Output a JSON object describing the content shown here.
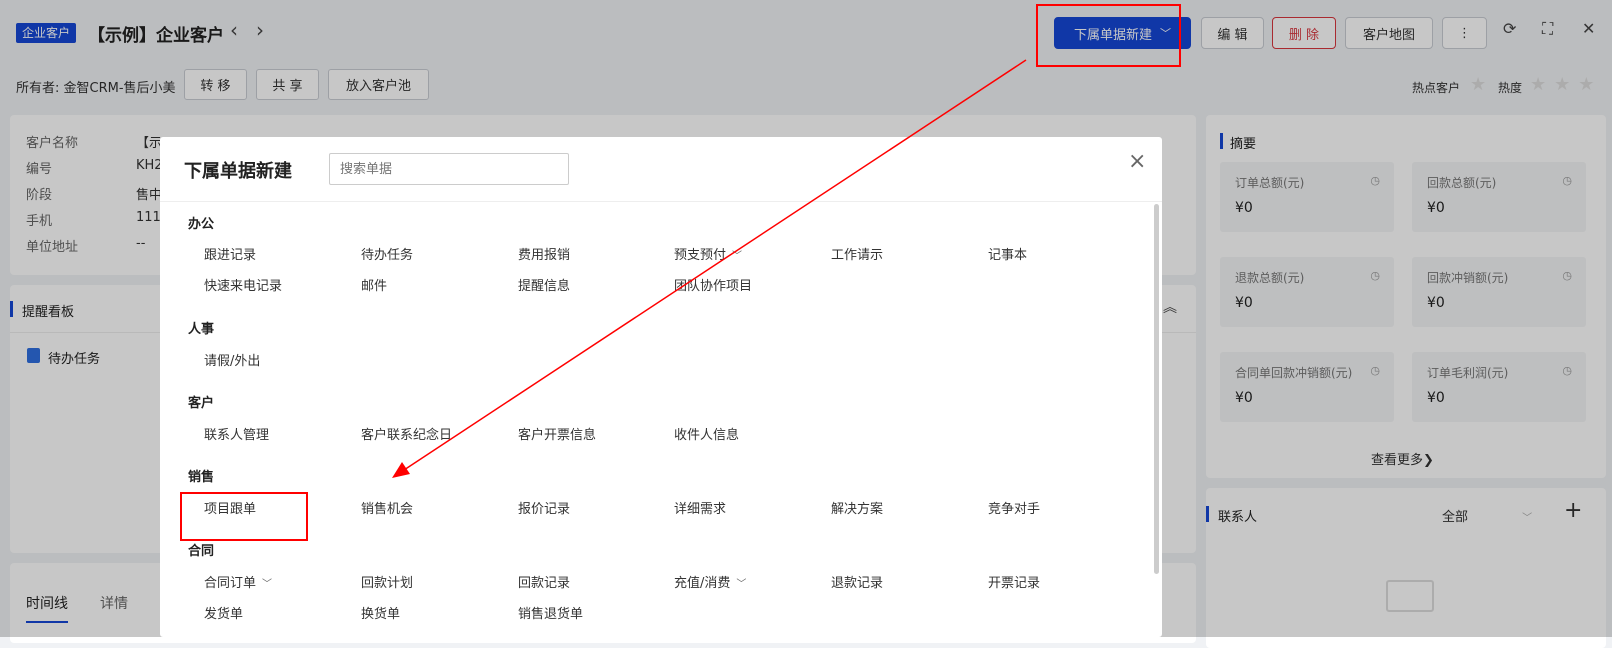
{
  "header": {
    "badge": "企业客户",
    "title": "【示例】企业客户",
    "prev_icon": "‹",
    "next_icon": "›",
    "new_sub_label": "下属单据新建",
    "edit_label": "编 辑",
    "delete_label": "删 除",
    "map_label": "客户地图",
    "more_icon": "⋮",
    "refresh_icon": "⟳",
    "fullscreen_icon": "⛶",
    "close_icon": "✕",
    "owner": "所有者: 金智CRM-售后小美",
    "transfer_label": "转 移",
    "share_label": "共 享",
    "pool_label": "放入客户池",
    "hot_label": "热点客户",
    "heat_label": "热度"
  },
  "info": {
    "labels": [
      "客户名称",
      "编号",
      "阶段",
      "手机",
      "单位地址"
    ],
    "values": [
      "【示",
      "KH2",
      "售中",
      "111",
      "--"
    ]
  },
  "reminder": {
    "title": "提醒看板",
    "item": "待办任务"
  },
  "tabs": [
    "时间线",
    "详情"
  ],
  "summary": {
    "title": "摘要",
    "items": [
      {
        "label": "订单总额(元)",
        "value": "¥0"
      },
      {
        "label": "回款总额(元)",
        "value": "¥0"
      },
      {
        "label": "退款总额(元)",
        "value": "¥0"
      },
      {
        "label": "回款冲销额(元)",
        "value": "¥0"
      },
      {
        "label": "合同单回款冲销额(元)",
        "value": "¥0"
      },
      {
        "label": "订单毛利润(元)",
        "value": "¥0"
      }
    ],
    "more": "查看更多"
  },
  "contacts": {
    "title": "联系人",
    "filter": "全部",
    "add_icon": "+"
  },
  "modal": {
    "title": "下属单据新建",
    "search_placeholder": "搜索单据",
    "close_icon": "×",
    "sections": [
      {
        "name": "办公",
        "items": [
          "跟进记录",
          "待办任务",
          "费用报销",
          "预支预付",
          "工作请示",
          "记事本",
          "快速来电记录",
          "邮件",
          "提醒信息",
          "团队协作项目"
        ]
      },
      {
        "name": "人事",
        "items": [
          "请假/外出"
        ]
      },
      {
        "name": "客户",
        "items": [
          "联系人管理",
          "客户联系纪念日",
          "客户开票信息",
          "收件人信息"
        ]
      },
      {
        "name": "销售",
        "items": [
          "项目跟单",
          "销售机会",
          "报价记录",
          "详细需求",
          "解决方案",
          "竞争对手"
        ]
      },
      {
        "name": "合同",
        "items": [
          "合同订单",
          "回款计划",
          "回款记录",
          "充值/消费",
          "退款记录",
          "开票记录",
          "发货单",
          "换货单",
          "销售退货单"
        ]
      }
    ]
  },
  "colors": {
    "primary": "#1547d6",
    "danger": "#d9363e",
    "annotation": "#ff0000"
  }
}
